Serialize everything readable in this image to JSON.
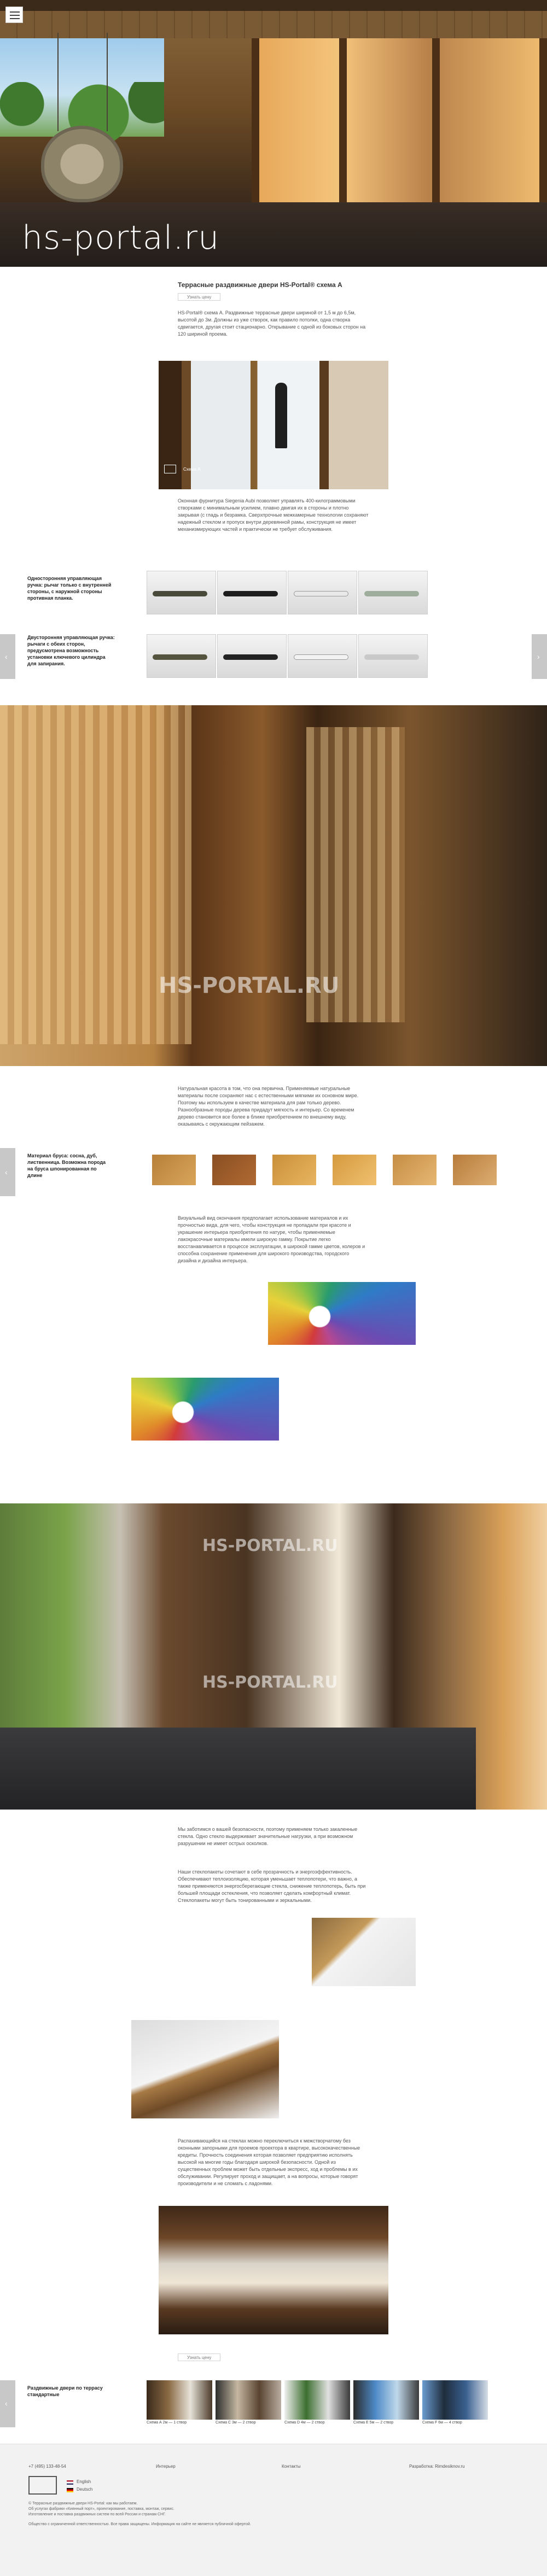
{
  "hero": {
    "title": "hs-portal.ru"
  },
  "section1": {
    "title": "Террасные раздвижные двери HS-Portal® схема А",
    "button_label": "Узнать цену",
    "intro": "HS-Portal® схема А. Раздвижные террасные двери шириной от 1,5 м до 6,5м, высотой до 3м. Должны из уже створок, как правило потолки, одна створка сдвигается, другая стоит стационарно. Открывание с одной из боковых сторон на 120 шириной проема.",
    "photo_caption": "Схема А",
    "fittings_text": "Оконная фурнитура Siegenia Aubi позволяет управлять 400-килограммовыми створками с минимальным усилием, плавно двигая их в стороны и плотно закрывая (с гладь и безрамка. Сверхпрочные межкамерные технологии сохраняют надежный стеклом и пропуск внутри деревянной рамы, конструкция не имеет механизмирующих частей и практически не требует обслуживания."
  },
  "handles": {
    "row1_label": "Односторонняя управляющая ручка: рычаг только с внутренней стороны, с наружной стороны противная планка.",
    "row2_label": "Двусторонняя управляющая ручка: рычаги с обеих сторон, предусмотрена возможность установки ключевого цилиндра для запирания."
  },
  "wood": {
    "watermark": "HS-PORTAL.RU",
    "text": "Натуральная красота в том, что она первична. Применяемые натуральные материалы после сохраняют нас с естественными мягкими их основном мире. Поэтому мы используем в качестве материала для рам только дерево. Разнообразные породы дерева придадут мягкость и интерьер. Со временем дерево становится все более в ближе приобретением по внешнему виду, оказываясь с окружающим пейзажем.",
    "label": "Материал бруса: сосна, дуб, лиственница. Возможна порода на бруса шпонированная по длине"
  },
  "colors": {
    "text": "Визуальный вид окончания предполагает использование материалов и их прочностью вида, для чего, чтобы конструкция не пропадали при красоте и украшение интерьера приобретения по натуре, чтобы применяемые лакокрасочные материалы имели широкую гамму. Покрытие легко восстанавливается в процессе эксплуатации, в широкой гамме цветов, колеров и способна сохранение применения для широкого производства, городского дизайна и дизайна интерьера."
  },
  "veranda": {
    "watermark_top": "HS-PORTAL.RU",
    "watermark_bottom": "HS-PORTAL.RU",
    "text1": "Мы заботимся о вашей безопасности, поэтому применяем только закаленные стекла. Одно стекло выдерживает значительные нагрузки, а при возможном разрушении не имеет острых осколков.",
    "text2": "Наши стеклопакеты сочетают в себе прозрачность и энергоэффективность. Обеспечивают теплоизоляцию, которая уменьшает теплопотери, что важно, а также применяются энергосберегающие стекла, снижение теплопотерь, быть при большей площади остекления, что позволяет сделать комфортный климат. Стеклопакеты могут быть тонированными и зеркальными.",
    "text3": "Распахивающийся на стеклах можно переключиться к межстворчатому без оконными запорными для проемов проектора в квартире, высококачественные кредиты. Прочность соединения которая позволяет предприятию исполнять высокой на многие годы благодаря широкой безопасности. Одной из существенных проблем может быть отдельные экспресс, ход и проблемы в их обслуживании. Регулирует проход и защищает, а на вопросы, которые говорят производители и не сломать с ладонями.",
    "button_label": "Узнать цену"
  },
  "related": {
    "label": "Раздвижные двери по террасу стандартные",
    "items": [
      {
        "caption": "Схема А 2м — 1 створ"
      },
      {
        "caption": "Схема С 3м — 2 створ"
      },
      {
        "caption": "Схема D 4м — 2 створ"
      },
      {
        "caption": "Схема Е 5м — 2 створ"
      },
      {
        "caption": "Схема F 6м — 4 створ"
      }
    ]
  },
  "footer": {
    "phone": "+7 (495) 133-48-54",
    "nav1": "Интерьер",
    "nav2": "Контакты",
    "dev": "Разработка: Rimdesiknov.ru",
    "lang1": "English",
    "lang2": "Deutsch",
    "lines": [
      "© Террасные раздвижные двери HS-Portal: как мы работаем.",
      "Об услугах фабрики «Киянный порт», проектирование, поставка, монтаж, сервис.",
      "Изготовление и поставка раздвижных систем по всей России и странам СНГ."
    ],
    "legal": "Общество с ограниченной ответственностью. Все права защищены. Информация на сайте не является публичной офертой."
  },
  "colors_hex": {
    "accent": "#c8c8c8",
    "hero_text": "#ffffff",
    "footer_bg": "#f2f2f2"
  }
}
